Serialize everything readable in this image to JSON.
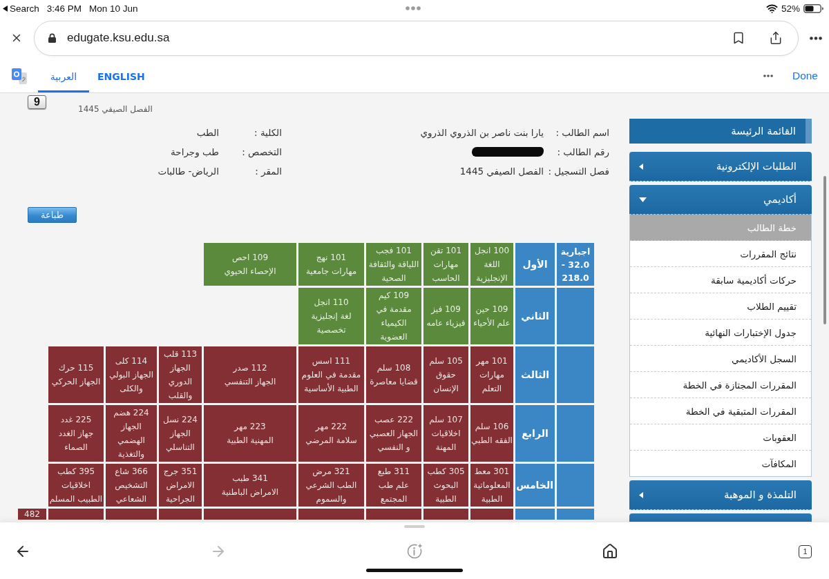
{
  "status_bar": {
    "back_label": "Search",
    "time": "3:46 PM",
    "date": "Mon 10 Jun",
    "battery": "52%"
  },
  "address_bar": {
    "url": "edugate.ksu.edu.sa"
  },
  "translate_bar": {
    "tabs": [
      {
        "label": "ENGLISH",
        "selected": false
      },
      {
        "label": "العربية",
        "selected": true
      }
    ],
    "done": "Done"
  },
  "page": {
    "badge": "9",
    "semester": "الفصل الصيفي 1445",
    "student_info": [
      {
        "label": "اسم الطالب :",
        "value": "يارا بنت ناصر بن الذروي الذروي"
      },
      {
        "label": "الكلية :",
        "value": "الطب"
      },
      {
        "label": "رقم الطالب :",
        "redacted": true
      },
      {
        "label": "التخصص :",
        "value": "طب وجراحة"
      },
      {
        "label": "فصل التسجيل :",
        "value": "الفصل الصيفي 1445"
      },
      {
        "label": "المقر :",
        "value": "الرياض- طالبات"
      }
    ],
    "print_button": "طباعة",
    "plan": {
      "levels": [
        {
          "name": "الأول",
          "category": "اجبارية 32.0 - 218.0",
          "courses": [
            {
              "code": "100 انجل",
              "name": "اللغة الإنجليزية",
              "color": "#5b8a3c"
            },
            {
              "code": "101 تقن",
              "name": "مهارات الحاسب",
              "color": "#5b8a3c"
            },
            {
              "code": "101 فجب",
              "name": "اللياقة والثقافة الصحية",
              "color": "#5b8a3c"
            },
            {
              "code": "101 نهج",
              "name": "مهارات جامعية",
              "color": "#5b8a3c"
            },
            {
              "code": "109 احص",
              "name": "الإحصاء الحيوي",
              "color": "#5b8a3c"
            }
          ]
        },
        {
          "name": "الثاني",
          "courses": [
            {
              "code": "109 حين",
              "name": "علم الأحياء",
              "color": "#5b8a3c"
            },
            {
              "code": "109 فيز",
              "name": "فيزياء عامه",
              "color": "#5b8a3c"
            },
            {
              "code": "109 كيم",
              "name": "مقدمة في الكيمياء العضوية",
              "color": "#5b8a3c"
            },
            {
              "code": "110 انجل",
              "name": "لغة إنجليزية تخصصية",
              "color": "#5b8a3c"
            }
          ]
        },
        {
          "name": "الثالث",
          "courses": [
            {
              "code": "101 مهر",
              "name": "مهارات التعلم",
              "color": "#832f33"
            },
            {
              "code": "105 سلم",
              "name": "حقوق الإنسان",
              "color": "#832f33"
            },
            {
              "code": "108 سلم",
              "name": "قضايا معاصرة",
              "color": "#832f33"
            },
            {
              "code": "111 اسس",
              "name": "مقدمة في العلوم الطبية الأساسية",
              "color": "#832f33"
            },
            {
              "code": "112 صدر",
              "name": "الجهاز التنفسي",
              "color": "#832f33"
            },
            {
              "code": "113 قلب",
              "name": "الجهاز الدوري والقلب",
              "color": "#832f33"
            },
            {
              "code": "114 كلى",
              "name": "الجهاز البولي والكلى",
              "color": "#832f33"
            },
            {
              "code": "115 حرك",
              "name": "الجهاز الحركي",
              "color": "#832f33"
            }
          ]
        },
        {
          "name": "الرابع",
          "courses": [
            {
              "code": "106 سلم",
              "name": "الفقه الطبي",
              "color": "#832f33"
            },
            {
              "code": "107 سلم",
              "name": "اخلاقيات المهنة",
              "color": "#832f33"
            },
            {
              "code": "222 عصب",
              "name": "الجهاز العصبي و النفسي",
              "color": "#832f33"
            },
            {
              "code": "222 مهر",
              "name": "سلامة المرضي",
              "color": "#832f33"
            },
            {
              "code": "223 مهر",
              "name": "المهنية الطبية",
              "color": "#832f33"
            },
            {
              "code": "224 نسل",
              "name": "الجهاز التناسلي",
              "color": "#832f33"
            },
            {
              "code": "224 هضم",
              "name": "الجهاز الهضمي والتغذية",
              "color": "#832f33"
            },
            {
              "code": "225 غدد",
              "name": "جهاز الغدد الصماء",
              "color": "#832f33"
            }
          ]
        },
        {
          "name": "الخامس",
          "courses": [
            {
              "code": "301 معط",
              "name": "المعلوماتية الطبية",
              "color": "#832f33"
            },
            {
              "code": "305 كطب",
              "name": "البحوث الطبية",
              "color": "#832f33"
            },
            {
              "code": "311 طبع",
              "name": "علم طب المجتمع",
              "color": "#832f33"
            },
            {
              "code": "321 مرض",
              "name": "الطب الشرعي والسموم",
              "color": "#832f33"
            },
            {
              "code": "341 طبب",
              "name": "الامراض الباطنية",
              "color": "#832f33"
            },
            {
              "code": "351 جرج",
              "name": "الامراض الجراحية",
              "color": "#832f33"
            },
            {
              "code": "366 شاع",
              "name": "التشخيص الشعاعي",
              "color": "#832f33"
            },
            {
              "code": "395 كطب",
              "name": "اخلاقيات الطبيب المسلم",
              "color": "#832f33"
            }
          ]
        },
        {
          "courses": [
            {
              "color": "#832f33"
            },
            {
              "color": "#832f33"
            },
            {
              "color": "#832f33"
            },
            {
              "color": "#832f33"
            },
            {
              "color": "#832f33"
            },
            {
              "color": "#832f33"
            },
            {
              "color": "#832f33"
            },
            {
              "color": "#832f33"
            },
            {
              "code": "482",
              "color": "#832f33"
            }
          ]
        }
      ]
    }
  },
  "sidebar": {
    "title": "القائمة الرئيسة",
    "sections": [
      {
        "title": "الطلبات الإلكترونية",
        "expanded": false
      },
      {
        "title": "أكاديمي",
        "expanded": true,
        "items": [
          {
            "label": "خطة الطالب",
            "selected": true
          },
          {
            "label": "نتائج المقررات",
            "selected": false
          },
          {
            "label": "حركات أكاديمية سابقة",
            "selected": false
          },
          {
            "label": "تقييم الطلاب",
            "selected": false
          },
          {
            "label": "جدول الإختبارات النهائية",
            "selected": false
          },
          {
            "label": "السجل الأكاديمي",
            "selected": false
          },
          {
            "label": "المقررات المجتازة في الخطة",
            "selected": false
          },
          {
            "label": "المقررات المتبقية في الخطة",
            "selected": false
          },
          {
            "label": "العقوبات",
            "selected": false
          },
          {
            "label": "المكافآت",
            "selected": false
          }
        ]
      },
      {
        "title": "التلمذة و الموهبة",
        "expanded": false
      }
    ]
  },
  "toolbar": {
    "buttons": [
      {
        "kind": "back",
        "disabled": false
      },
      {
        "kind": "forward",
        "disabled": true
      },
      {
        "kind": "assistant",
        "disabled": false
      },
      {
        "kind": "home",
        "disabled": false
      },
      {
        "kind": "tabs",
        "label": "1",
        "disabled": false
      }
    ]
  }
}
